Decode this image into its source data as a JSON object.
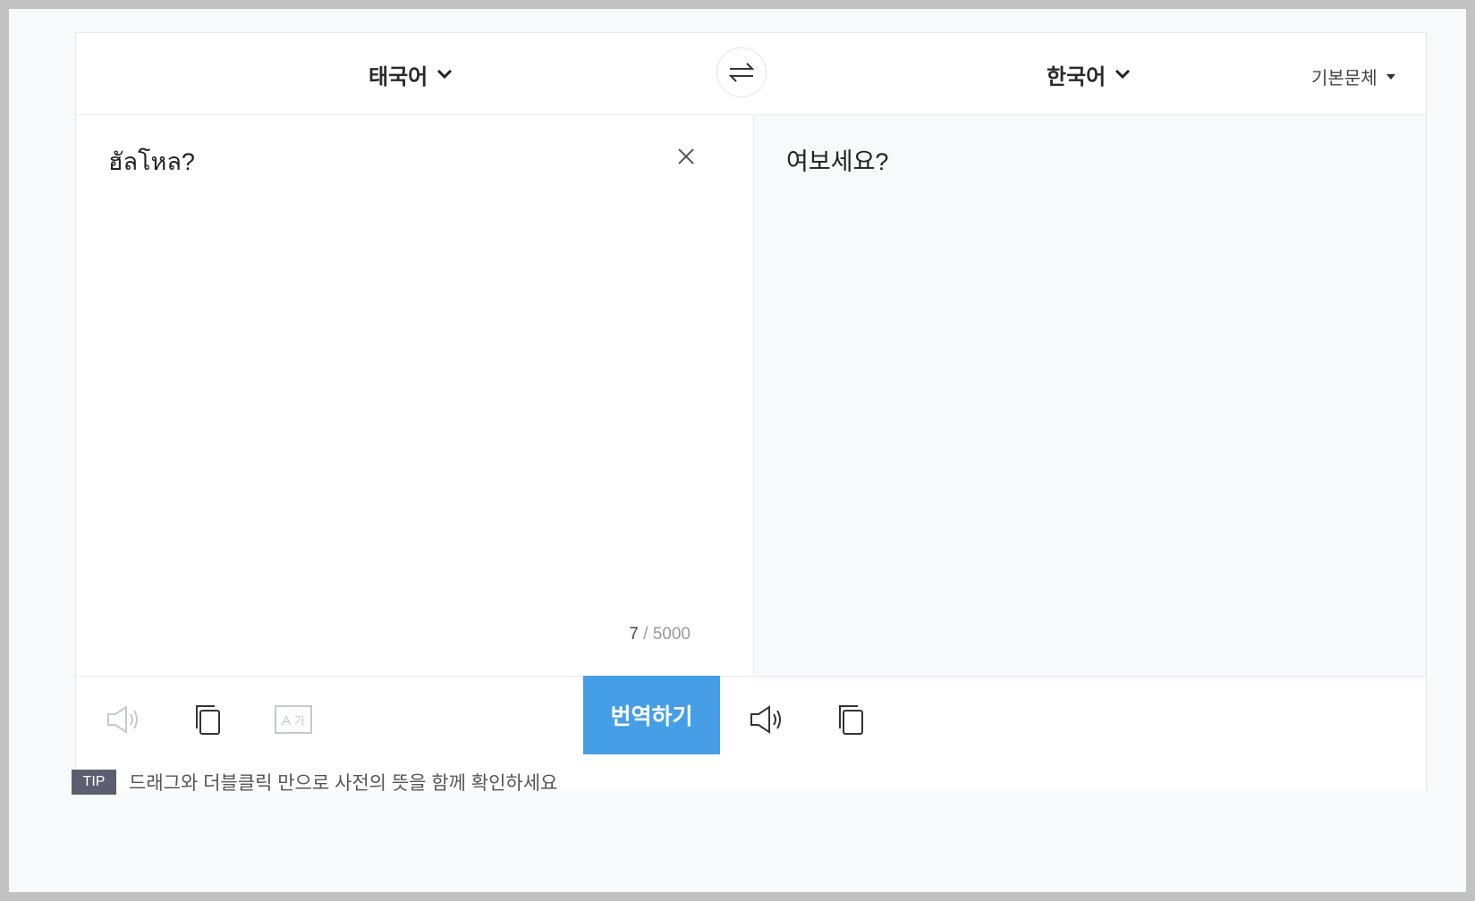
{
  "languages": {
    "source": "태국어",
    "target": "한국어"
  },
  "font_select": {
    "label": "기본문체"
  },
  "source": {
    "text": "ฮัลโหล?",
    "count": "7",
    "count_sep": " / ",
    "max": "5000"
  },
  "target": {
    "text": "여보세요?"
  },
  "actions": {
    "translate_label": "번역하기"
  },
  "tip": {
    "badge": "TIP",
    "text": "드래그와 더블클릭 만으로 사전의 뜻을 함께 확인하세요"
  },
  "icons": {
    "source_lang_chevron": "chevron-down-icon",
    "target_lang_chevron": "chevron-down-icon",
    "swap": "swap-arrows-icon",
    "clear": "close-icon",
    "speak": "speaker-icon",
    "copy": "copy-icon",
    "handwriting": "font-convert-icon"
  },
  "colors": {
    "accent": "#469ee6",
    "tip_badge": "#5c5e70"
  }
}
